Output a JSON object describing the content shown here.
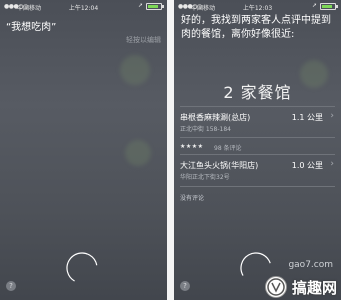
{
  "left": {
    "status": {
      "carrier": "中国移动",
      "time": "上午12:04"
    },
    "query": "“我想吃肉”",
    "edit_hint": "轻按以编辑",
    "help": "?"
  },
  "right": {
    "status": {
      "carrier": "中国移动",
      "time": "上午12:03"
    },
    "response": "好的，我找到两家客人点评中提到肉的餐馆，离你好像很近:",
    "count_title": "2 家餐馆",
    "restaurants": [
      {
        "name": "串根香麻辣涮(总店)",
        "address": "正北中街 158-184",
        "distance": "1.1 公里",
        "stars": "★★★★",
        "reviews": "98 条评论"
      },
      {
        "name": "大江鱼头火锅(华阳店)",
        "address": "华阳正北下街32号",
        "distance": "1.0 公里",
        "no_reviews": "没有评论"
      }
    ],
    "help": "?"
  },
  "watermark": {
    "domain": "gao7.com",
    "brand": "搞趣网"
  }
}
